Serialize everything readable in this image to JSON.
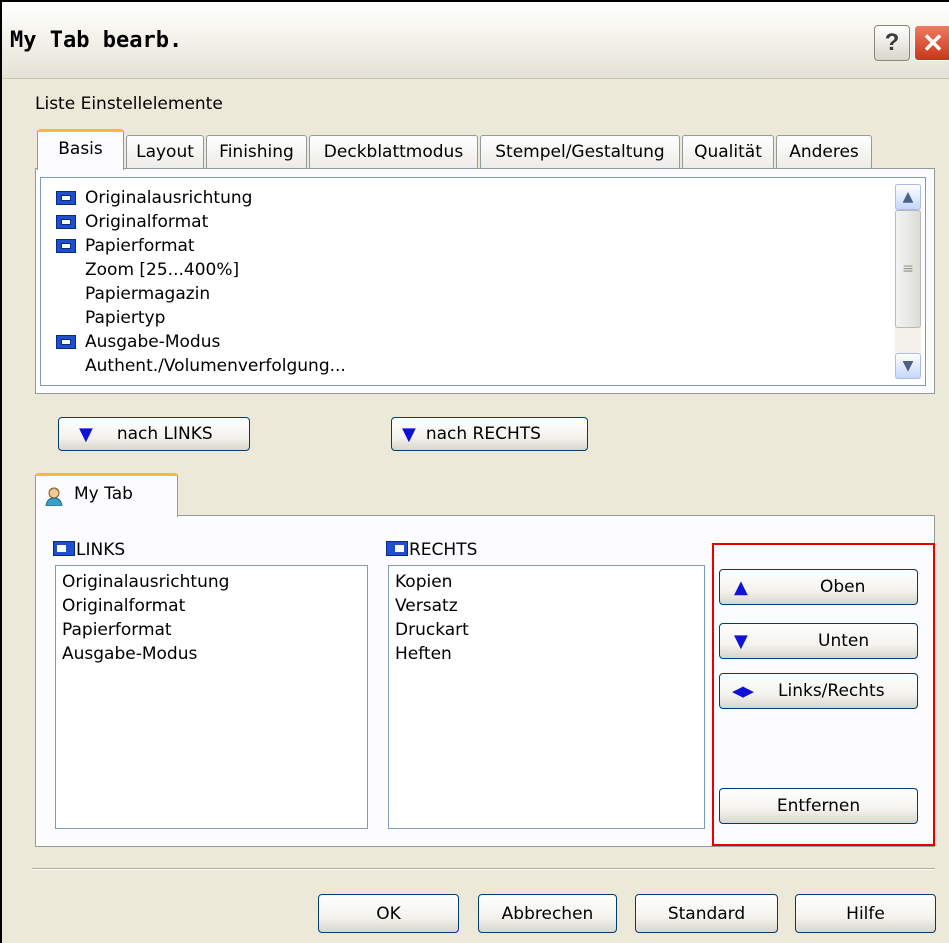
{
  "window": {
    "title": "My Tab bearb."
  },
  "section_label": "Liste Einstellelemente",
  "tabs": [
    {
      "label": "Basis",
      "active": true
    },
    {
      "label": "Layout"
    },
    {
      "label": "Finishing"
    },
    {
      "label": "Deckblattmodus"
    },
    {
      "label": "Stempel/Gestaltung"
    },
    {
      "label": "Qualität"
    },
    {
      "label": "Anderes"
    }
  ],
  "settings_list": {
    "items": [
      {
        "label": "Originalausrichtung",
        "icon": "layout-property-icon"
      },
      {
        "label": "Originalformat",
        "icon": "layout-property-icon"
      },
      {
        "label": "Papierformat",
        "icon": "layout-property-icon"
      },
      {
        "label": "Zoom [25...400%]",
        "icon": null
      },
      {
        "label": "Papiermagazin",
        "icon": null
      },
      {
        "label": "Papiertyp",
        "icon": null
      },
      {
        "label": "Ausgabe-Modus",
        "icon": "layout-property-icon"
      },
      {
        "label": "Authent./Volumenverfolgung...",
        "icon": null
      }
    ]
  },
  "move_buttons": {
    "left": "nach LINKS",
    "right": "nach RECHTS"
  },
  "mytab": {
    "tab_label": "My Tab",
    "left_header": "LINKS",
    "right_header": "RECHTS",
    "left_items": [
      "Originalausrichtung",
      "Originalformat",
      "Papierformat",
      "Ausgabe-Modus"
    ],
    "right_items": [
      "Kopien",
      "Versatz",
      "Druckart",
      "Heften"
    ]
  },
  "order_buttons": {
    "up": "Oben",
    "down": "Unten",
    "swap": "Links/Rechts",
    "remove": "Entfernen"
  },
  "footer": {
    "ok": "OK",
    "cancel": "Abbrechen",
    "default": "Standard",
    "help": "Hilfe"
  },
  "colors": {
    "highlight": "#e60000",
    "accent_tab": "#f5b94a",
    "glyph_blue": "#1010d8"
  }
}
